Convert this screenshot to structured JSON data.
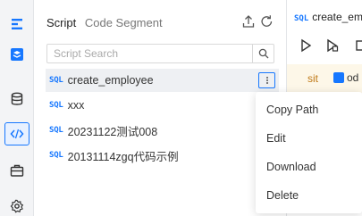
{
  "colors": {
    "accent": "#1677ff",
    "env_text": "#c07a19",
    "env_bg": "#fdf7e8"
  },
  "rail": {
    "icons": [
      "menu-icon",
      "datasource-icon",
      "database-icon",
      "code-icon",
      "toolbox-icon",
      "settings-icon"
    ],
    "active": "code-icon"
  },
  "panel": {
    "tabs": {
      "script": "Script",
      "code_segment": "Code Segment"
    },
    "search_placeholder": "Script Search",
    "sql_tag": "SQL",
    "scripts": [
      {
        "name": "create_employee",
        "selected": true
      },
      {
        "name": "xxx",
        "selected": false
      },
      {
        "name": "20231122测试008",
        "selected": false
      },
      {
        "name": "20131114zgq代码示例",
        "selected": false
      }
    ]
  },
  "editor": {
    "title": "create_empl",
    "env": "sit",
    "datasource": "od"
  },
  "context_menu": {
    "items": [
      "Copy Path",
      "Edit",
      "Download",
      "Delete"
    ]
  }
}
